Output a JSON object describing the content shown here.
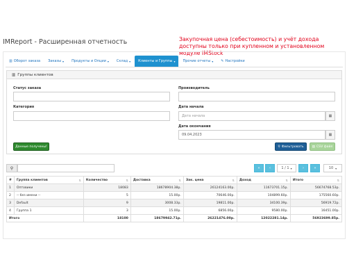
{
  "page_title": "IMReport - Расширенная отчетность",
  "notice": "Закупочная цена (себестоимость) и учёт дохода доступны только при купленном и установленном модуле IMStock",
  "tabs": [
    {
      "label": "Оборот заказа",
      "icon": "bar-chart-icon",
      "dropdown": false,
      "active": false
    },
    {
      "label": "Заказы",
      "icon": "",
      "dropdown": true,
      "active": false
    },
    {
      "label": "Продукты и Опции",
      "icon": "",
      "dropdown": true,
      "active": false
    },
    {
      "label": "Склад",
      "icon": "",
      "dropdown": true,
      "active": false
    },
    {
      "label": "Клиенты и Группы",
      "icon": "",
      "dropdown": true,
      "active": true
    },
    {
      "label": "Прочие отчеты",
      "icon": "",
      "dropdown": true,
      "active": false
    },
    {
      "label": "Настройки",
      "icon": "wrench-icon",
      "dropdown": false,
      "active": false
    }
  ],
  "panel": {
    "title": "Группы клиентов",
    "filters": {
      "order_status": {
        "label": "Статус заказа",
        "value": ""
      },
      "manufacturer": {
        "label": "Производитель",
        "value": ""
      },
      "category": {
        "label": "Категория",
        "value": ""
      },
      "date_start": {
        "label": "Дата начала",
        "placeholder": "Дата начала",
        "value": ""
      },
      "date_end": {
        "label": "Дата окончания",
        "value": "09.04.2023"
      }
    },
    "btn_data_received": "Данные получены!",
    "btn_filter": "Фильтровать",
    "btn_csv": "CSV файл"
  },
  "pagination": {
    "first": "«",
    "prev": "‹",
    "page_select": "1 / 1",
    "next": "›",
    "last": "»",
    "per_page": "10"
  },
  "table": {
    "columns": [
      "#",
      "Группа клиентов",
      "Количество",
      "Доставка",
      "Зак. цена",
      "Доход",
      "Итого"
    ],
    "rows": [
      [
        "1",
        "Оптовики",
        "18083",
        "18678904.38р.",
        "26124163.00р.",
        "11673701.15р.",
        "56674768.53р."
      ],
      [
        "2",
        "-- без имени --",
        "5",
        "15.00р.",
        "70646.00р.",
        "104899.60р.",
        "175560.60р."
      ],
      [
        "3",
        "Default",
        "9",
        "3008.33р.",
        "19811.00р.",
        "34100.39р.",
        "56919.72р."
      ],
      [
        "4",
        "Группа 1",
        "3",
        "15.00р.",
        "6856.00р.",
        "9580.00р.",
        "16451.00р."
      ]
    ],
    "total": [
      "Итого",
      "",
      "18100",
      "18679942.71р.",
      "26221476.00р.",
      "12022281.14р.",
      "56923699.85р."
    ]
  }
}
